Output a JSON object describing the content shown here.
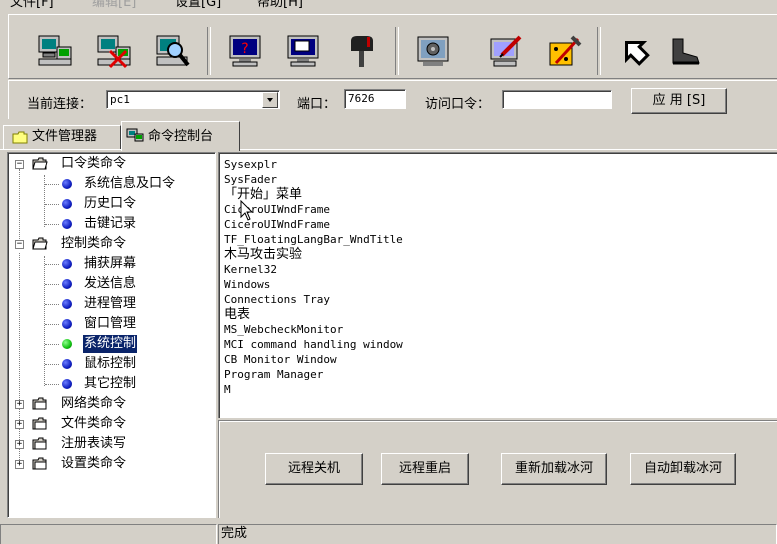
{
  "menu": {
    "file": "文件[F]",
    "edit": "编辑[E]",
    "settings": "设置[G]",
    "help": "帮助[H]"
  },
  "toolbar": {
    "icons": [
      "computer-connect-icon",
      "computer-disconnect-icon",
      "computer-search-icon",
      "monitor-help-icon",
      "monitor-window-icon",
      "mailbox-icon",
      "gear-monitor-icon",
      "monitor-edit-icon",
      "tools-icon",
      "arrow-icon",
      "boot-icon"
    ]
  },
  "connection": {
    "current_label": "当前连接：",
    "current_value": "pc1",
    "port_label": "端口：",
    "port_value": "7626",
    "password_label": "访问口令：",
    "password_value": "",
    "apply_label": "应 用 [S]"
  },
  "tabs": {
    "file_manager": "文件管理器",
    "command_console": "命令控制台"
  },
  "tree": {
    "groups": [
      {
        "label": "口令类命令",
        "items": [
          "系统信息及口令",
          "历史口令",
          "击键记录"
        ]
      },
      {
        "label": "控制类命令",
        "items": [
          "捕获屏幕",
          "发送信息",
          "进程管理",
          "窗口管理",
          "系统控制",
          "鼠标控制",
          "其它控制"
        ]
      },
      {
        "label": "网络类命令"
      },
      {
        "label": "文件类命令"
      },
      {
        "label": "注册表读写"
      },
      {
        "label": "设置类命令"
      }
    ]
  },
  "output_lines": [
    "Sysexplr",
    "SysFader",
    "「开始」菜单",
    "CiceroUIWndFrame",
    "CiceroUIWndFrame",
    "TF_FloatingLangBar_WndTitle",
    "木马攻击实验",
    "Kernel32",
    "Windows",
    "Connections Tray",
    "电表",
    "MS_WebcheckMonitor",
    "MCI command handling window",
    "CB Monitor Window",
    "Program Manager",
    "M"
  ],
  "actions": {
    "remote_shutdown": "远程关机",
    "remote_restart": "远程重启",
    "reload_binghe": "重新加载冰河",
    "auto_unload_binghe": "自动卸载冰河"
  },
  "status": {
    "left": "",
    "right": "完成"
  },
  "colors": {
    "window_bg": "#d4d0c8",
    "selection": "#0a246a"
  }
}
